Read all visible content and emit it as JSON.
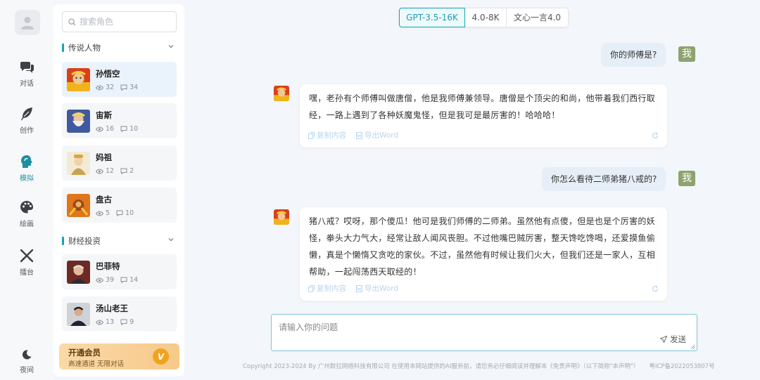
{
  "nav": {
    "items": [
      {
        "label": "对话",
        "icon": "chat-icon"
      },
      {
        "label": "创作",
        "icon": "feather-icon"
      },
      {
        "label": "模拟",
        "icon": "head-icon"
      },
      {
        "label": "绘画",
        "icon": "palette-icon"
      },
      {
        "label": "擂台",
        "icon": "swords-icon"
      }
    ],
    "night_label": "夜间",
    "active_color": "#1d8f9f"
  },
  "panel": {
    "search_placeholder": "搜索角色",
    "groups": [
      {
        "title": "传说人物",
        "roles": [
          {
            "name": "孙悟空",
            "views": "32",
            "chats": "34"
          },
          {
            "name": "宙斯",
            "views": "16",
            "chats": "10"
          },
          {
            "name": "妈祖",
            "views": "12",
            "chats": "2"
          },
          {
            "name": "盘古",
            "views": "5",
            "chats": "10"
          }
        ]
      },
      {
        "title": "财经投资",
        "roles": [
          {
            "name": "巴菲特",
            "views": "39",
            "chats": "14"
          },
          {
            "name": "汤山老王",
            "views": "13",
            "chats": "9"
          }
        ]
      }
    ],
    "vip": {
      "title": "开通会员",
      "subtitle": "高速通道 无限对话",
      "badge": "V"
    }
  },
  "tabs": [
    "GPT-3.5-16K",
    "4.0-8K",
    "文心一言4.0"
  ],
  "chat": {
    "me_label": "我",
    "messages": [
      {
        "role": "user",
        "text": "你的师傅是?"
      },
      {
        "role": "bot",
        "text": "嘿，老孙有个师傅叫做唐僧，他是我师傅兼领导。唐僧是个顶尖的和尚，他带着我们西行取经，一路上遇到了各种妖魔鬼怪，但是我可是最厉害的！哈哈哈！"
      },
      {
        "role": "user",
        "text": "你怎么看待二师弟猪八戒的?"
      },
      {
        "role": "bot",
        "text": "猪八戒？哎呀，那个傻瓜！他可是我们师傅的二师弟。虽然他有点傻，但是也是个厉害的妖怪，拳头大力气大，经常让敌人闻风丧胆。不过他嘴巴贼厉害，整天馋吃馋喝，还爱摸鱼偷懒，真是个懒惰又贪吃的家伙。不过，虽然他有时候让我们火大，但我们还是一家人，互相帮助，一起闯荡西天取经的！"
      }
    ],
    "copy_label": "复制内容",
    "export_label": "导出Word"
  },
  "input": {
    "placeholder": "请输入你的问题",
    "send_label": "发送"
  },
  "footer": {
    "copyright": "Copyright 2023-2024 By 广州默拉网络科技有限公司 在使用本网站提供的AI服务前，请您务必仔细阅读并理解本《免责声明》（以下简称\"本声明\"）",
    "icp": "粤ICP备2022053807号"
  }
}
